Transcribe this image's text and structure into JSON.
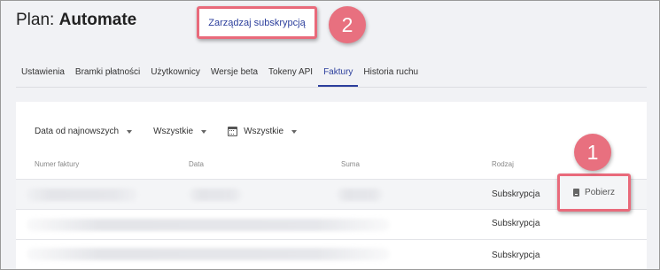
{
  "header": {
    "plan_prefix": "Plan:",
    "plan_name": "Automate",
    "manage_label": "Zarządzaj subskrypcją"
  },
  "callouts": {
    "one": "1",
    "two": "2"
  },
  "tabs": [
    {
      "label": "Ustawienia",
      "active": false
    },
    {
      "label": "Bramki płatności",
      "active": false
    },
    {
      "label": "Użytkownicy",
      "active": false
    },
    {
      "label": "Wersje beta",
      "active": false
    },
    {
      "label": "Tokeny API",
      "active": false
    },
    {
      "label": "Faktury",
      "active": true
    },
    {
      "label": "Historia ruchu",
      "active": false
    }
  ],
  "filters": {
    "sort": "Data od najnowszych",
    "type": "Wszystkie",
    "date": "Wszystkie"
  },
  "table": {
    "columns": [
      "Numer faktury",
      "Data",
      "Suma",
      "Rodzaj"
    ],
    "rows": [
      {
        "rodzaj": "Subskrypcja",
        "action": "Pobierz"
      },
      {
        "rodzaj": "Subskrypcja"
      },
      {
        "rodzaj": "Subskrypcja"
      }
    ]
  },
  "colors": {
    "accent": "#2b3e9c",
    "callout": "#e8707f",
    "background": "#f1f2f5"
  }
}
